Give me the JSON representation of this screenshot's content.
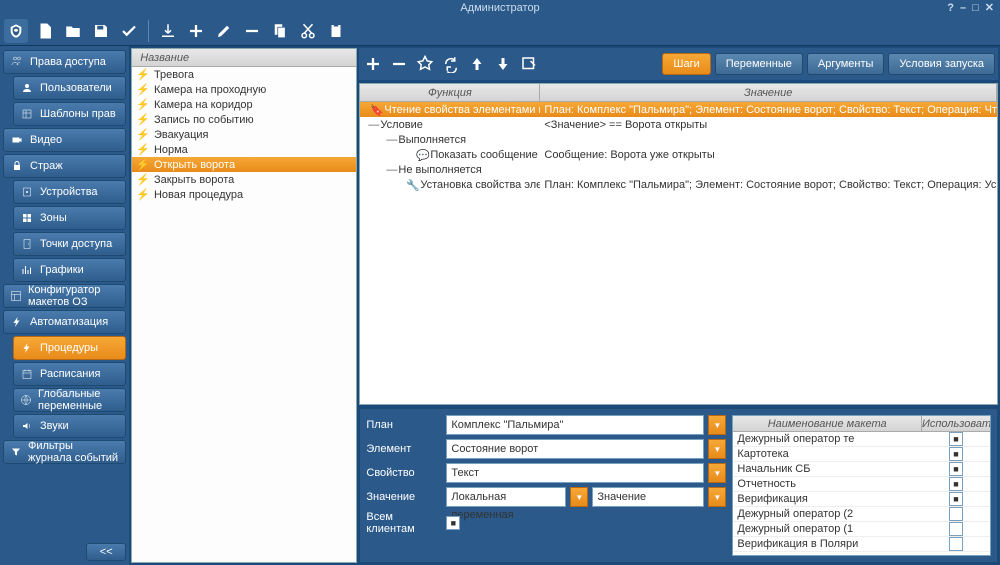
{
  "title": "Администратор",
  "sidebar": [
    {
      "label": "Права доступа",
      "icon": "users",
      "sub": false
    },
    {
      "label": "Пользователи",
      "icon": "user",
      "sub": true
    },
    {
      "label": "Шаблоны прав",
      "icon": "templates",
      "sub": true
    },
    {
      "label": "Видео",
      "icon": "camera",
      "sub": false
    },
    {
      "label": "Страж",
      "icon": "lock",
      "sub": false
    },
    {
      "label": "Устройства",
      "icon": "device",
      "sub": true
    },
    {
      "label": "Зоны",
      "icon": "zones",
      "sub": true
    },
    {
      "label": "Точки доступа",
      "icon": "door",
      "sub": true
    },
    {
      "label": "Графики",
      "icon": "chart",
      "sub": true
    },
    {
      "label": "Конфигуратор макетов ОЗ",
      "icon": "layout",
      "sub": false
    },
    {
      "label": "Автоматизация",
      "icon": "bolt",
      "sub": false
    },
    {
      "label": "Процедуры",
      "icon": "bolt",
      "sub": true,
      "active": true
    },
    {
      "label": "Расписания",
      "icon": "calendar",
      "sub": true
    },
    {
      "label": "Глобальные переменные",
      "icon": "globe",
      "sub": true
    },
    {
      "label": "Звуки",
      "icon": "sound",
      "sub": true
    },
    {
      "label": "Фильтры журнала событий",
      "icon": "filter",
      "sub": false
    }
  ],
  "collapse": "<<",
  "center_header": "Название",
  "procedures": [
    "Тревога",
    "Камера на проходную",
    "Камера на коридор",
    "Запись по событию",
    "Эвакуация",
    "Норма",
    "Открыть ворота",
    "Закрыть ворота",
    "Новая процедура"
  ],
  "proc_selected": 6,
  "tabs": [
    "Шаги",
    "Переменные",
    "Аргументы",
    "Условия запуска"
  ],
  "tab_selected": 0,
  "steps_head": {
    "fn": "Функция",
    "val": "Значение"
  },
  "steps": [
    {
      "indent": 0,
      "toggle": "",
      "icon": "read",
      "fn": "Чтение свойства элементами план",
      "val": "План: Комплекс \"Пальмира\"; Элемент: Состояние ворот; Свойство: Текст; Операция: Чт",
      "sel": true
    },
    {
      "indent": 0,
      "toggle": "—",
      "icon": "",
      "fn": "Условие",
      "val": "<Значение> == Ворота открыты"
    },
    {
      "indent": 1,
      "toggle": "—",
      "icon": "",
      "fn": "Выполняется",
      "val": ""
    },
    {
      "indent": 2,
      "toggle": "",
      "icon": "msg",
      "fn": "Показать сообщение",
      "val": "Сообщение: Ворота уже открыты"
    },
    {
      "indent": 1,
      "toggle": "—",
      "icon": "",
      "fn": "Не выполняется",
      "val": ""
    },
    {
      "indent": 2,
      "toggle": "",
      "icon": "set",
      "fn": "Установка свойства элемент",
      "val": "План: Комплекс \"Пальмира\"; Элемент: Состояние ворот; Свойство: Текст; Операция: Ус"
    }
  ],
  "props": {
    "plan_l": "План",
    "plan_v": "Комплекс \"Пальмира\"",
    "elem_l": "Элемент",
    "elem_v": "Состояние ворот",
    "prop_l": "Свойство",
    "prop_v": "Текст",
    "val_l": "Значение",
    "val_v1": "Локальная переменная",
    "val_v2": "Значение",
    "all_l": "Всем клиентам"
  },
  "layouts_head": {
    "name": "Наименование макета",
    "use": "Использовать"
  },
  "layouts": [
    {
      "name": "Дежурный оператор те",
      "chk": true
    },
    {
      "name": "Картотека",
      "chk": true
    },
    {
      "name": "Начальник СБ",
      "chk": true
    },
    {
      "name": "Отчетность",
      "chk": true
    },
    {
      "name": "Верификация",
      "chk": true
    },
    {
      "name": "Дежурный оператор (2",
      "chk": false
    },
    {
      "name": "Дежурный оператор (1",
      "chk": false
    },
    {
      "name": "Верификация в Поляри",
      "chk": false
    }
  ]
}
